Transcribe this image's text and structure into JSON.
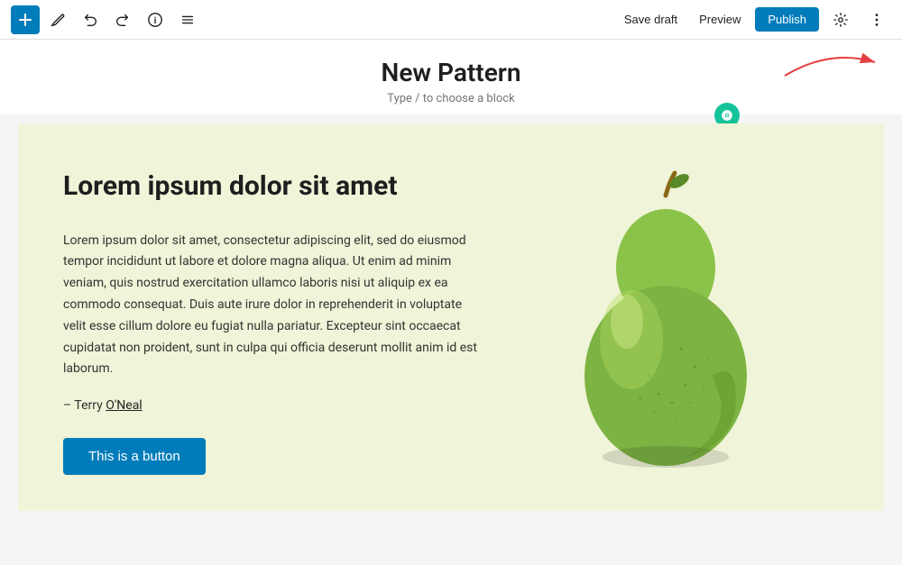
{
  "toolbar": {
    "add_label": "+",
    "save_draft_label": "Save draft",
    "preview_label": "Preview",
    "publish_label": "Publish"
  },
  "title_area": {
    "title": "New Pattern",
    "subtitle": "Type / to choose a block"
  },
  "content": {
    "heading": "Lorem ipsum dolor sit amet",
    "body": "Lorem ipsum dolor sit amet, consectetur adipiscing elit, sed do eiusmod tempor incididunt ut labore et dolore magna aliqua. Ut enim ad minim veniam, quis nostrud exercitation ullamco laboris nisi ut aliquip ex ea commodo consequat. Duis aute irure dolor in reprehenderit in voluptate velit esse cillum dolore eu fugiat nulla pariatur. Excepteur sint occaecat cupidatat non proident, sunt in culpa qui officia deserunt mollit anim id est laborum.",
    "attribution_prefix": "– Terry ",
    "attribution_link": "O'Neal",
    "cta_label": "This is a button"
  },
  "colors": {
    "brand_blue": "#007cba",
    "content_bg": "#f0f4d8",
    "grammarly_green": "#15c39a"
  }
}
